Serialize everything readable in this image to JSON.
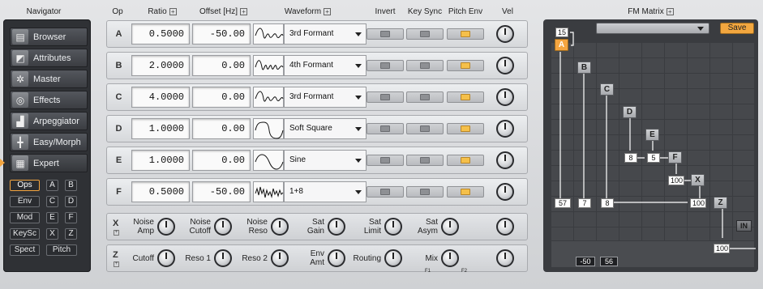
{
  "navigator": {
    "title": "Navigator",
    "items": [
      {
        "label": "Browser",
        "icon": "folder-icon"
      },
      {
        "label": "Attributes",
        "icon": "attributes-icon"
      },
      {
        "label": "Master",
        "icon": "gear-icon"
      },
      {
        "label": "Effects",
        "icon": "effects-icon"
      },
      {
        "label": "Arpeggiator",
        "icon": "stairs-icon"
      },
      {
        "label": "Easy/Morph",
        "icon": "grid-icon"
      },
      {
        "label": "Expert",
        "icon": "expert-icon"
      }
    ],
    "sub": {
      "ops": "Ops",
      "a": "A",
      "b": "B",
      "env": "Env",
      "c": "C",
      "d": "D",
      "mod": "Mod",
      "e": "E",
      "f": "F",
      "keysc": "KeySc",
      "x": "X",
      "z": "Z",
      "spect": "Spect",
      "pitch": "Pitch"
    }
  },
  "headers": {
    "op": "Op",
    "ratio": "Ratio",
    "offset": "Offset [Hz]",
    "waveform": "Waveform",
    "invert": "Invert",
    "keysync": "Key Sync",
    "pitchenv": "Pitch Env",
    "vel": "Vel",
    "fm_matrix": "FM Matrix"
  },
  "operators": [
    {
      "letter": "A",
      "ratio": "0.5000",
      "offset": "-50.00",
      "waveform": "3rd Formant",
      "invert": false,
      "keysync": false,
      "pitchenv": true
    },
    {
      "letter": "B",
      "ratio": "2.0000",
      "offset": "0.00",
      "waveform": "4th Formant",
      "invert": false,
      "keysync": false,
      "pitchenv": true
    },
    {
      "letter": "C",
      "ratio": "4.0000",
      "offset": "0.00",
      "waveform": "3rd Formant",
      "invert": false,
      "keysync": false,
      "pitchenv": true
    },
    {
      "letter": "D",
      "ratio": "1.0000",
      "offset": "0.00",
      "waveform": "Soft Square",
      "invert": false,
      "keysync": false,
      "pitchenv": true
    },
    {
      "letter": "E",
      "ratio": "1.0000",
      "offset": "0.00",
      "waveform": "Sine",
      "invert": false,
      "keysync": false,
      "pitchenv": true
    },
    {
      "letter": "F",
      "ratio": "0.5000",
      "offset": "-50.00",
      "waveform": "1+8",
      "invert": false,
      "keysync": false,
      "pitchenv": true
    }
  ],
  "x_panel": {
    "letter": "X",
    "params": [
      "Noise\nAmp",
      "Noise\nCutoff",
      "Noise\nReso",
      "Sat\nGain",
      "Sat\nLimit",
      "Sat\nAsym"
    ]
  },
  "z_panel": {
    "letter": "Z",
    "params": [
      "Cutoff",
      "Reso 1",
      "Reso 2",
      "Env\nAmt",
      "Routing",
      "Mix"
    ],
    "mix_left": "F1",
    "mix_right": "F2"
  },
  "matrix": {
    "save": "Save",
    "values": {
      "fifteen": "15",
      "a57": "57",
      "b7": "7",
      "c8": "8",
      "d8": "8",
      "e5": "5",
      "f100": "100",
      "x100": "100",
      "z100": "100",
      "neg50": "-50",
      "v56": "56"
    },
    "nodes": [
      "A",
      "B",
      "C",
      "D",
      "E",
      "F",
      "X",
      "Z"
    ],
    "in": "IN"
  },
  "colors": {
    "accent": "#f4a540",
    "panel_dark": "#3a3c40"
  }
}
